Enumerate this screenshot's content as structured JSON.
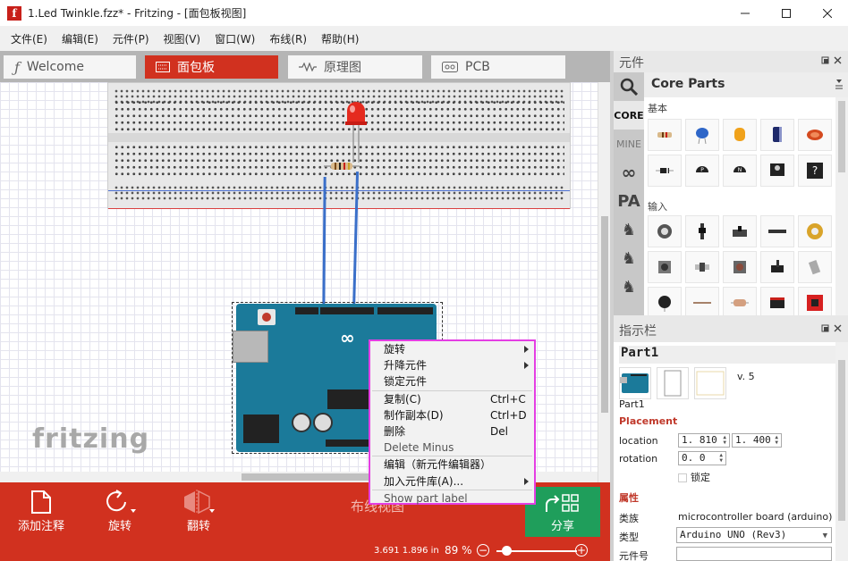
{
  "window": {
    "title": "1.Led Twinkle.fzz* - Fritzing - [面包板视图]",
    "app_icon": "f"
  },
  "menu": [
    "文件(E)",
    "编辑(E)",
    "元件(P)",
    "视图(V)",
    "窗口(W)",
    "布线(R)",
    "帮助(H)"
  ],
  "tabs": [
    {
      "label": "Welcome",
      "icon": "fritzing-f-icon"
    },
    {
      "label": "面包板",
      "icon": "breadboard-icon",
      "active": true
    },
    {
      "label": "原理图",
      "icon": "resistor-icon"
    },
    {
      "label": "PCB",
      "icon": "pcb-icon"
    }
  ],
  "canvas": {
    "logo_text": "fritzing",
    "arduino_logo": "∞"
  },
  "context_menu": [
    {
      "label": "旋转",
      "submenu": true
    },
    {
      "label": "升降元件",
      "submenu": true
    },
    {
      "label": "锁定元件"
    },
    {
      "label": "复制(C)",
      "shortcut": "Ctrl+C"
    },
    {
      "label": "制作副本(D)",
      "shortcut": "Ctrl+D"
    },
    {
      "label": "删除",
      "shortcut": "Del"
    },
    {
      "label": "Delete Minus"
    },
    {
      "label": "编辑（新元件编辑器）"
    },
    {
      "label": "加入元件库(A)...",
      "submenu": true
    },
    {
      "label": "Show part label"
    }
  ],
  "toolbar": {
    "add_note": "添加注释",
    "rotate": "旋转",
    "flip": "翻转",
    "route_status": "布线视图",
    "share": "分享"
  },
  "status": {
    "coords": "3.691 1.896 in",
    "zoom": "89 %",
    "zoom_level": 0.08
  },
  "parts_bin": {
    "panel_title": "元件",
    "bin_title": "Core Parts",
    "tabs": [
      "CORE",
      "MINE",
      "∞",
      "PA",
      "♞",
      "♞",
      "♞"
    ],
    "section_basic": "基本",
    "section_input": "输入"
  },
  "inspector": {
    "panel_title": "指示栏",
    "part_name": "Part1",
    "version": "v. 5",
    "part_label": "Part1",
    "placement_title": "Placement",
    "location_label": "location",
    "location_x": "1. 810",
    "location_y": "1. 400",
    "rotation_label": "rotation",
    "rotation_value": "0. 0",
    "lock_label": "锁定",
    "properties_title": "属性",
    "family_label": "类族",
    "family_value": "microcontroller board (arduino)",
    "type_label": "类型",
    "type_value": "Arduino UNO (Rev3)",
    "part_number_label": "元件号"
  },
  "colors": {
    "accent_red": "#d1311f",
    "share_green": "#1f9e5b",
    "context_border": "#e43ee3",
    "arduino_blue": "#1b7a9a",
    "wire_blue": "#3a6fc9"
  }
}
